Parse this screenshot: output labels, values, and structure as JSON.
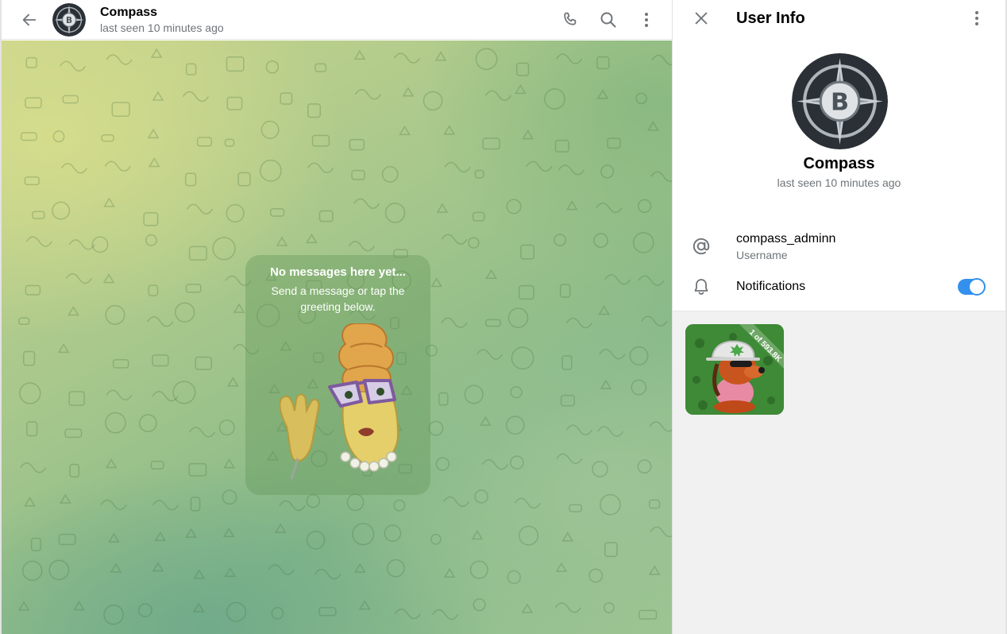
{
  "chat": {
    "title": "Compass",
    "status": "last seen 10 minutes ago",
    "empty_state": {
      "title": "No messages here yet...",
      "subtitle": "Send a message or tap the greeting below."
    }
  },
  "info_panel": {
    "title": "User Info",
    "name": "Compass",
    "status": "last seen 10 minutes ago",
    "username": {
      "value": "compass_adminn",
      "label": "Username"
    },
    "notifications": {
      "label": "Notifications",
      "enabled": true
    },
    "gift": {
      "badge": "1 of 593.8K"
    }
  },
  "colors": {
    "accent": "#3390ec",
    "secondary_text": "#707579",
    "panel_background": "#f1f1f1"
  },
  "icons": [
    "back-arrow-icon",
    "phone-icon",
    "search-icon",
    "more-vertical-icon",
    "close-icon",
    "at-sign-icon",
    "bell-icon"
  ]
}
